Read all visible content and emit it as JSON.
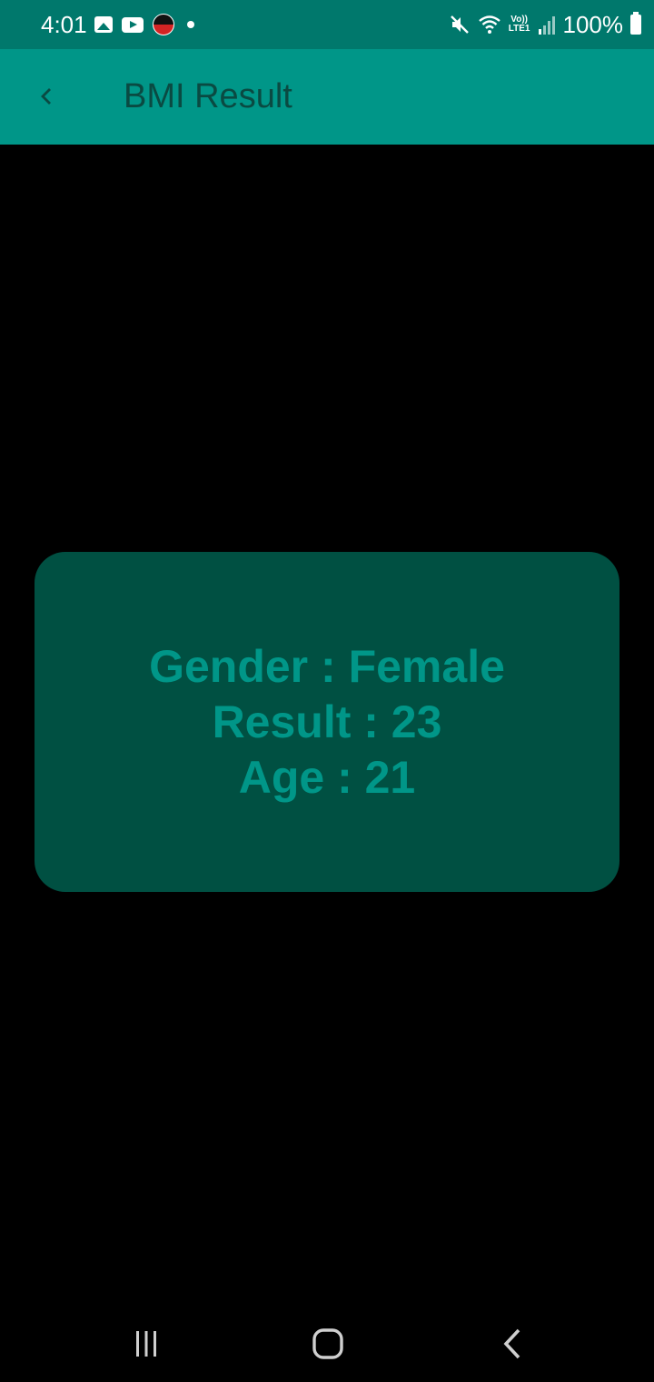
{
  "status_bar": {
    "time": "4:01",
    "battery": "100%",
    "network_label_top": "Vo))",
    "network_label_bottom": "LTE1",
    "icons": [
      "gallery-icon",
      "youtube-icon",
      "app-badge-icon",
      "notification-dot-icon",
      "mute-icon",
      "wifi-icon",
      "volte-icon",
      "signal-icon",
      "battery-icon"
    ]
  },
  "app_bar": {
    "title": "BMI Result",
    "back_icon": "chevron-left-icon",
    "background": "#009688",
    "title_color": "#0A4A42"
  },
  "result_card": {
    "gender_line": "Gender : Female",
    "result_line": "Result : 23",
    "age_line": "Age : 21",
    "background": "#005042",
    "text_color": "#009688"
  },
  "nav_bar": {
    "buttons": [
      "recent-apps-icon",
      "home-icon",
      "back-icon"
    ]
  },
  "colors": {
    "status_bar": "#00786C",
    "page_background": "#000000"
  }
}
